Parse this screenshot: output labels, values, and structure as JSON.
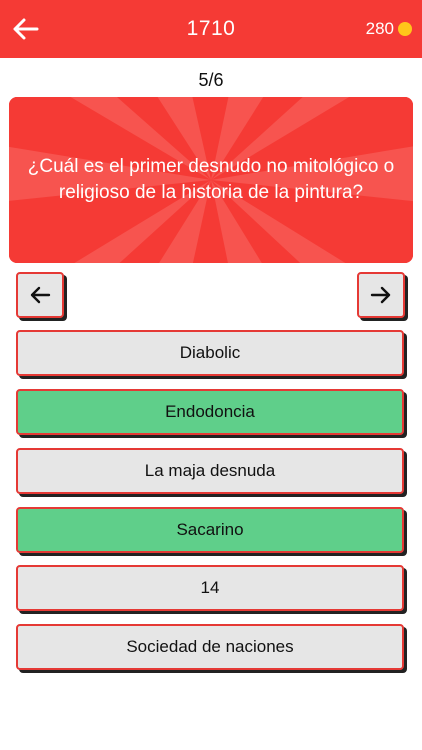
{
  "header": {
    "title": "1710",
    "coins": "280",
    "colors": {
      "bar": "#f53a35",
      "coin": "#ffc61a"
    }
  },
  "progress": "5/6",
  "question": {
    "text": "¿Cuál es el primer desnudo no mitológico o religioso de la historia de la pintura?"
  },
  "navigation": {
    "prev_icon": "arrow-left-icon",
    "next_icon": "arrow-right-icon"
  },
  "options": [
    {
      "label": "Diabolic",
      "state": "default"
    },
    {
      "label": "Endodoncia",
      "state": "highlighted"
    },
    {
      "label": "La maja desnuda",
      "state": "default"
    },
    {
      "label": "Sacarino",
      "state": "highlighted"
    },
    {
      "label": "14",
      "state": "default"
    },
    {
      "label": "Sociedad de naciones",
      "state": "default"
    }
  ],
  "colors": {
    "option_default": "#e6e6e6",
    "option_highlighted": "#5fcf8a",
    "option_border": "#e53935"
  }
}
